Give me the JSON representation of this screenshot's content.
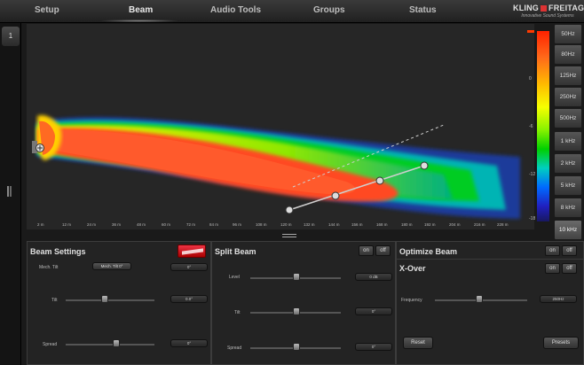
{
  "nav": {
    "tabs": [
      {
        "label": "Setup"
      },
      {
        "label": "Beam"
      },
      {
        "label": "Audio Tools"
      },
      {
        "label": "Groups"
      },
      {
        "label": "Status"
      }
    ],
    "brand_left": "KLING",
    "brand_right": "FREITAG",
    "brand_sub": "Innovative Sound Systems"
  },
  "rail": {
    "page": "1"
  },
  "plot": {
    "x_ticks": [
      "2 m",
      "12 m",
      "24 m",
      "36 m",
      "48 m",
      "60 m",
      "72 m",
      "84 m",
      "96 m",
      "108 m",
      "120 m",
      "132 m",
      "144 m",
      "156 m",
      "168 m",
      "180 m",
      "192 m",
      "204 m",
      "216 m",
      "228 m"
    ],
    "cb_ticks": [
      "0",
      "-6",
      "-12",
      "-18"
    ]
  },
  "freq_buttons": [
    "50Hz",
    "80Hz",
    "125Hz",
    "250Hz",
    "500Hz",
    "1 kHz",
    "2 kHz",
    "5 kHz",
    "8 kHz",
    "10 kHz"
  ],
  "beam_settings": {
    "title": "Beam Settings",
    "mech_tilt_label": "Mech. Tilt",
    "mech_tilt_value": "Mech. Tilt 0°",
    "mech_tilt_field": "0°",
    "tilt_label": "Tilt",
    "tilt_value": "0.0°",
    "spread_label": "Spread",
    "spread_value": "0°"
  },
  "split_beam": {
    "title": "Split Beam",
    "on_label": "on",
    "off_label": "off",
    "level_label": "Level",
    "level_value": "0 dB",
    "tilt_label": "Tilt",
    "tilt_value": "0°",
    "spread_label": "Spread",
    "spread_value": "0°"
  },
  "optimize_beam": {
    "title": "Optimize Beam",
    "on_label": "on",
    "off_label": "off"
  },
  "xover": {
    "title": "X-Over",
    "on_label": "on",
    "off_label": "off",
    "frequency_label": "Frequency",
    "frequency_value": "250Hz",
    "reset_label": "Reset",
    "presets_label": "Presets"
  }
}
